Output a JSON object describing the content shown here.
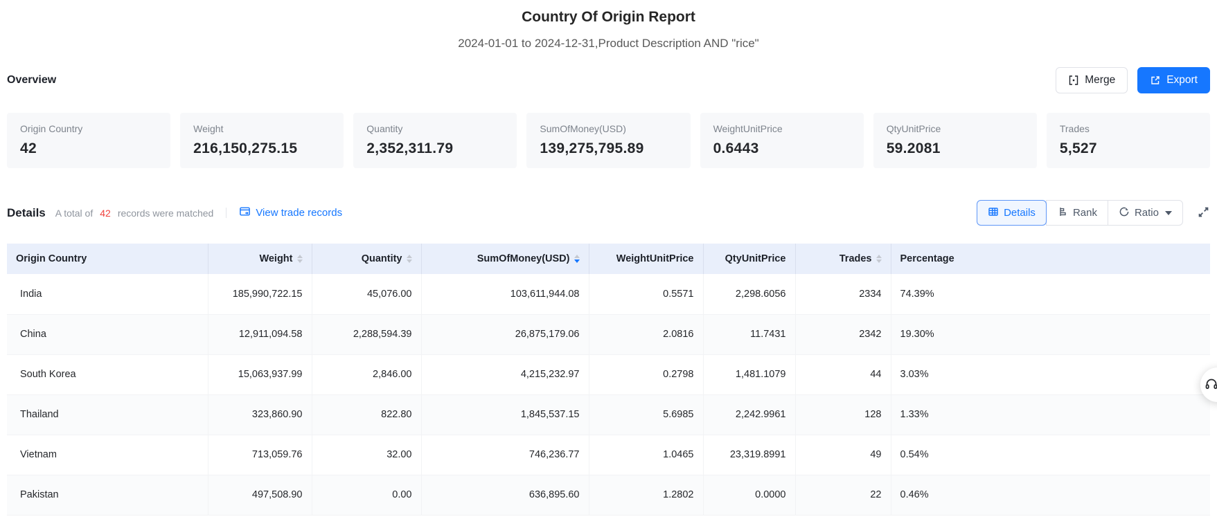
{
  "report": {
    "title": "Country Of Origin Report",
    "subtitle": "2024-01-01 to 2024-12-31,Product Description AND \"rice\""
  },
  "overview": {
    "heading": "Overview",
    "merge_label": "Merge",
    "export_label": "Export",
    "cards": [
      {
        "label": "Origin Country",
        "value": "42"
      },
      {
        "label": "Weight",
        "value": "216,150,275.15"
      },
      {
        "label": "Quantity",
        "value": "2,352,311.79"
      },
      {
        "label": "SumOfMoney(USD)",
        "value": "139,275,795.89"
      },
      {
        "label": "WeightUnitPrice",
        "value": "0.6443"
      },
      {
        "label": "QtyUnitPrice",
        "value": "59.2081"
      },
      {
        "label": "Trades",
        "value": "5,527"
      }
    ]
  },
  "details": {
    "heading": "Details",
    "summary_prefix": "A total of",
    "summary_count": "42",
    "summary_suffix": "records were matched",
    "view_link_label": "View trade records",
    "view_tabs": {
      "details": "Details",
      "rank": "Rank",
      "ratio": "Ratio"
    }
  },
  "table": {
    "columns": [
      {
        "label": "Origin Country",
        "align": "left",
        "sortable": false,
        "sort": "none"
      },
      {
        "label": "Weight",
        "align": "right",
        "sortable": true,
        "sort": "none"
      },
      {
        "label": "Quantity",
        "align": "right",
        "sortable": true,
        "sort": "none"
      },
      {
        "label": "SumOfMoney(USD)",
        "align": "right",
        "sortable": true,
        "sort": "desc"
      },
      {
        "label": "WeightUnitPrice",
        "align": "right",
        "sortable": false,
        "sort": "none"
      },
      {
        "label": "QtyUnitPrice",
        "align": "right",
        "sortable": false,
        "sort": "none"
      },
      {
        "label": "Trades",
        "align": "right",
        "sortable": true,
        "sort": "none"
      },
      {
        "label": "Percentage",
        "align": "left",
        "sortable": false,
        "sort": "none"
      }
    ],
    "rows": [
      [
        "India",
        "185,990,722.15",
        "45,076.00",
        "103,611,944.08",
        "0.5571",
        "2,298.6056",
        "2334",
        "74.39%"
      ],
      [
        "China",
        "12,911,094.58",
        "2,288,594.39",
        "26,875,179.06",
        "2.0816",
        "11.7431",
        "2342",
        "19.30%"
      ],
      [
        "South Korea",
        "15,063,937.99",
        "2,846.00",
        "4,215,232.97",
        "0.2798",
        "1,481.1079",
        "44",
        "3.03%"
      ],
      [
        "Thailand",
        "323,860.90",
        "822.80",
        "1,845,537.15",
        "5.6985",
        "2,242.9961",
        "128",
        "1.33%"
      ],
      [
        "Vietnam",
        "713,059.76",
        "32.00",
        "746,236.77",
        "1.0465",
        "23,319.8991",
        "49",
        "0.54%"
      ],
      [
        "Pakistan",
        "497,508.90",
        "0.00",
        "636,895.60",
        "1.2802",
        "0.0000",
        "22",
        "0.46%"
      ]
    ]
  },
  "icons": {
    "merge": "merge-cells-icon",
    "export": "external-link-icon",
    "view_trade": "trade-records-icon",
    "details_tab": "table-icon",
    "rank_tab": "rank-bars-icon",
    "ratio_tab": "pie-ring-icon",
    "ratio_caret": "caret-down-icon",
    "fullscreen": "fullscreen-expand-icon",
    "support": "headset-icon"
  },
  "colors": {
    "accent_blue": "#1677ff",
    "count_red": "#f0413c",
    "table_header_bg": "#e9effb",
    "card_bg": "#f7f8fa"
  }
}
